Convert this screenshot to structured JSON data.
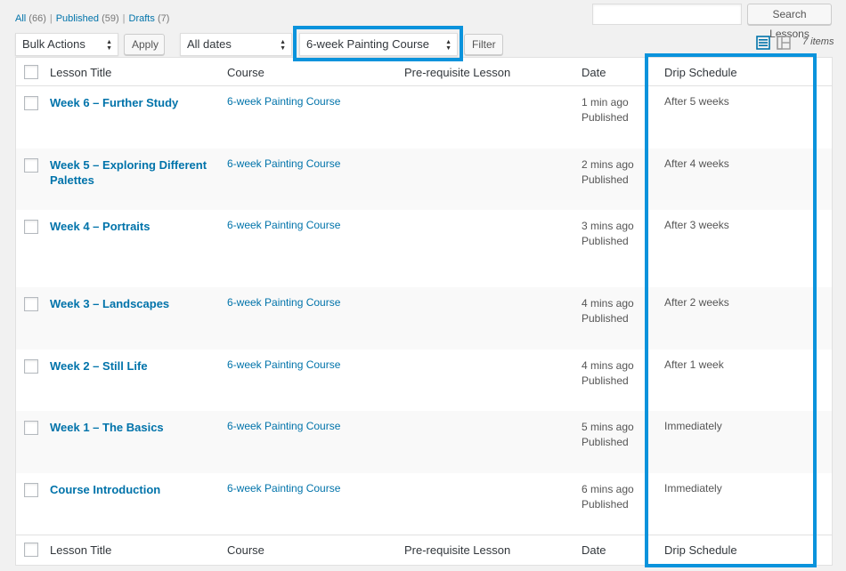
{
  "status_filters": {
    "all_label": "All",
    "all_count": "(66)",
    "published_label": "Published",
    "published_count": "(59)",
    "drafts_label": "Drafts",
    "drafts_count": "(7)",
    "separator": "|"
  },
  "search": {
    "placeholder": "",
    "button_label": "Search Lessons"
  },
  "toolbar": {
    "bulk_actions": "Bulk Actions",
    "apply_label": "Apply",
    "dates": "All dates",
    "course_filter": "6-week Painting Course",
    "filter_label": "Filter",
    "items_count": "7 items"
  },
  "columns": {
    "title": "Lesson Title",
    "course": "Course",
    "prereq": "Pre-requisite Lesson",
    "date": "Date",
    "drip": "Drip Schedule"
  },
  "rows": [
    {
      "title": "Week 6 – Further Study",
      "course": "6-week Painting Course",
      "date_ago": "1 min ago",
      "status": "Published",
      "drip": "After 5 weeks"
    },
    {
      "title": "Week 5 – Exploring Different Palettes",
      "course": "6-week Painting Course",
      "date_ago": "2 mins ago",
      "status": "Published",
      "drip": "After 4 weeks"
    },
    {
      "title": "Week 4 – Portraits",
      "course": "6-week Painting Course",
      "date_ago": "3 mins ago",
      "status": "Published",
      "drip": "After 3 weeks"
    },
    {
      "title": "Week 3 – Landscapes",
      "course": "6-week Painting Course",
      "date_ago": "4 mins ago",
      "status": "Published",
      "drip": "After 2 weeks"
    },
    {
      "title": "Week 2 – Still Life",
      "course": "6-week Painting Course",
      "date_ago": "4 mins ago",
      "status": "Published",
      "drip": "After 1 week"
    },
    {
      "title": "Week 1 – The Basics",
      "course": "6-week Painting Course",
      "date_ago": "5 mins ago",
      "status": "Published",
      "drip": "Immediately"
    },
    {
      "title": "Course Introduction",
      "course": "6-week Painting Course",
      "date_ago": "6 mins ago",
      "status": "Published",
      "drip": "Immediately"
    }
  ],
  "colors": {
    "link": "#0073aa",
    "highlight": "#0a93dc",
    "active_view": "#0073aa"
  },
  "icons": {
    "list_view": "list-view-icon",
    "excerpt_view": "excerpt-view-icon",
    "select_arrow": "updown-arrow-icon"
  }
}
